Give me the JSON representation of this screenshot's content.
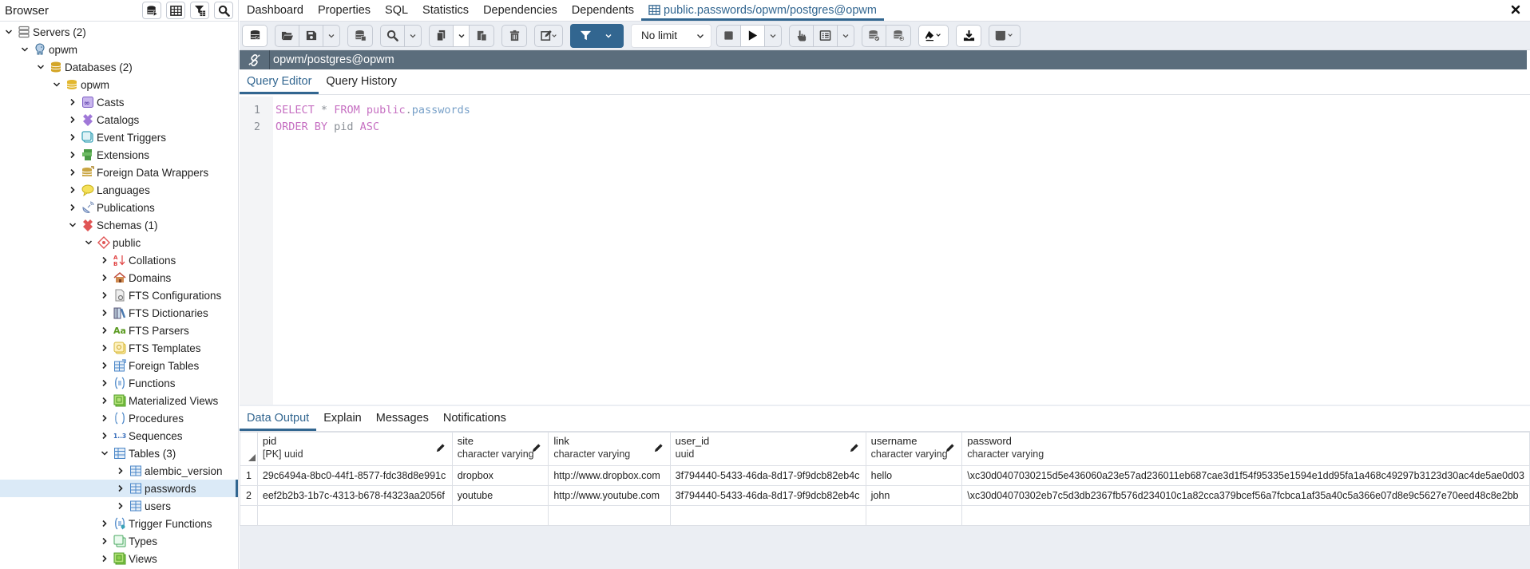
{
  "browser": {
    "title": "Browser",
    "header_buttons": [
      {
        "name": "query-tool-icon"
      },
      {
        "name": "view-data-icon"
      },
      {
        "name": "filtered-rows-icon"
      },
      {
        "name": "search-objects-icon"
      }
    ],
    "tree": [
      {
        "label": "Servers (2)",
        "level": 0,
        "expanded": true,
        "icon": "servers-icon"
      },
      {
        "label": "opwm",
        "level": 1,
        "expanded": true,
        "icon": "postgres-elephant-icon"
      },
      {
        "label": "Databases (2)",
        "level": 2,
        "expanded": true,
        "icon": "databases-icon"
      },
      {
        "label": "opwm",
        "level": 3,
        "expanded": true,
        "icon": "database-icon"
      },
      {
        "label": "Casts",
        "level": 4,
        "expanded": false,
        "icon": "casts-icon"
      },
      {
        "label": "Catalogs",
        "level": 4,
        "expanded": false,
        "icon": "catalogs-icon"
      },
      {
        "label": "Event Triggers",
        "level": 4,
        "expanded": false,
        "icon": "event-triggers-icon"
      },
      {
        "label": "Extensions",
        "level": 4,
        "expanded": false,
        "icon": "extensions-icon"
      },
      {
        "label": "Foreign Data Wrappers",
        "level": 4,
        "expanded": false,
        "icon": "foreign-data-wrappers-icon"
      },
      {
        "label": "Languages",
        "level": 4,
        "expanded": false,
        "icon": "languages-icon"
      },
      {
        "label": "Publications",
        "level": 4,
        "expanded": false,
        "icon": "publications-icon"
      },
      {
        "label": "Schemas (1)",
        "level": 4,
        "expanded": true,
        "icon": "schemas-icon"
      },
      {
        "label": "public",
        "level": 5,
        "expanded": true,
        "icon": "schema-icon"
      },
      {
        "label": "Collations",
        "level": 6,
        "expanded": false,
        "icon": "collations-icon"
      },
      {
        "label": "Domains",
        "level": 6,
        "expanded": false,
        "icon": "domains-icon"
      },
      {
        "label": "FTS Configurations",
        "level": 6,
        "expanded": false,
        "icon": "fts-configurations-icon"
      },
      {
        "label": "FTS Dictionaries",
        "level": 6,
        "expanded": false,
        "icon": "fts-dictionaries-icon"
      },
      {
        "label": "FTS Parsers",
        "level": 6,
        "expanded": false,
        "icon": "fts-parsers-icon"
      },
      {
        "label": "FTS Templates",
        "level": 6,
        "expanded": false,
        "icon": "fts-templates-icon"
      },
      {
        "label": "Foreign Tables",
        "level": 6,
        "expanded": false,
        "icon": "foreign-tables-icon"
      },
      {
        "label": "Functions",
        "level": 6,
        "expanded": false,
        "icon": "functions-icon"
      },
      {
        "label": "Materialized Views",
        "level": 6,
        "expanded": false,
        "icon": "materialized-views-icon"
      },
      {
        "label": "Procedures",
        "level": 6,
        "expanded": false,
        "icon": "procedures-icon"
      },
      {
        "label": "Sequences",
        "level": 6,
        "expanded": false,
        "icon": "sequences-icon"
      },
      {
        "label": "Tables (3)",
        "level": 6,
        "expanded": true,
        "icon": "tables-icon"
      },
      {
        "label": "alembic_version",
        "level": 7,
        "expanded": false,
        "icon": "table-icon"
      },
      {
        "label": "passwords",
        "level": 7,
        "expanded": false,
        "icon": "table-icon",
        "selected": true
      },
      {
        "label": "users",
        "level": 7,
        "expanded": false,
        "icon": "table-icon"
      },
      {
        "label": "Trigger Functions",
        "level": 6,
        "expanded": false,
        "icon": "trigger-functions-icon"
      },
      {
        "label": "Types",
        "level": 6,
        "expanded": false,
        "icon": "types-icon"
      },
      {
        "label": "Views",
        "level": 6,
        "expanded": false,
        "icon": "views-icon"
      }
    ]
  },
  "tabs": [
    {
      "label": "Dashboard"
    },
    {
      "label": "Properties"
    },
    {
      "label": "SQL"
    },
    {
      "label": "Statistics"
    },
    {
      "label": "Dependencies"
    },
    {
      "label": "Dependents"
    },
    {
      "label": "public.passwords/opwm/postgres@opwm",
      "active": true
    }
  ],
  "toolbar": {
    "limit_value": "No limit"
  },
  "connection": {
    "label": "opwm/postgres@opwm"
  },
  "query_tabs": [
    {
      "label": "Query Editor",
      "active": true
    },
    {
      "label": "Query History"
    }
  ],
  "editor": {
    "lines": [
      {
        "num": "1",
        "tokens": [
          {
            "t": "SELECT",
            "c": "kw"
          },
          {
            "t": " ",
            "c": "plain"
          },
          {
            "t": "*",
            "c": "op"
          },
          {
            "t": " ",
            "c": "plain"
          },
          {
            "t": "FROM",
            "c": "kw"
          },
          {
            "t": " ",
            "c": "plain"
          },
          {
            "t": "public",
            "c": "kw"
          },
          {
            "t": ".",
            "c": "op"
          },
          {
            "t": "passwords",
            "c": "id"
          }
        ]
      },
      {
        "num": "2",
        "tokens": [
          {
            "t": "ORDER BY",
            "c": "kw"
          },
          {
            "t": " pid ",
            "c": "plain"
          },
          {
            "t": "ASC",
            "c": "kw"
          }
        ]
      }
    ]
  },
  "output_tabs": [
    {
      "label": "Data Output",
      "active": true
    },
    {
      "label": "Explain"
    },
    {
      "label": "Messages"
    },
    {
      "label": "Notifications"
    }
  ],
  "grid": {
    "columns": [
      {
        "name": "pid",
        "type": "[PK] uuid"
      },
      {
        "name": "site",
        "type": "character varying"
      },
      {
        "name": "link",
        "type": "character varying"
      },
      {
        "name": "user_id",
        "type": "uuid"
      },
      {
        "name": "username",
        "type": "character varying"
      },
      {
        "name": "password",
        "type": "character varying"
      }
    ],
    "rows": [
      {
        "num": "1",
        "cells": [
          "29c6494a-8bc0-44f1-8577-fdc38d8e991c",
          "dropbox",
          "http://www.dropbox.com",
          "3f794440-5433-46da-8d17-9f9dcb82eb4c",
          "hello",
          "\\xc30d0407030215d5e436060a23e57ad236011eb687cae3d1f54f95335e1594e1dd95fa1a468c49297b3123d30ac4de5ae0d03"
        ]
      },
      {
        "num": "2",
        "cells": [
          "eef2b2b3-1b7c-4313-b678-f4323aa2056f",
          "youtube",
          "http://www.youtube.com",
          "3f794440-5433-46da-8d17-9f9dcb82eb4c",
          "john",
          "\\xc30d04070302eb7c5d3db2367fb576d234010c1a82cca379bcef56a7fcbca1af35a40c5a366e07d8e9c5627e70eed48c8e2bb"
        ]
      }
    ]
  },
  "colors": {
    "accent": "#326690",
    "connection_bar": "#5b6d7c",
    "toolbar_bg": "#ebeef3",
    "keyword": "#c670c2",
    "identifier": "#77a0c8",
    "selection": "#dbeaf7"
  }
}
